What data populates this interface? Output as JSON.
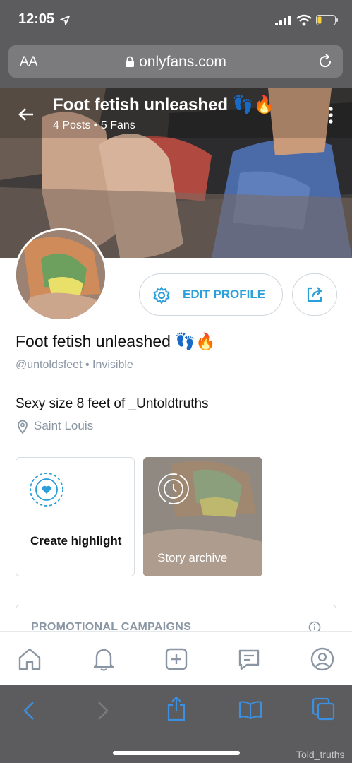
{
  "status_bar": {
    "time": "12:05"
  },
  "url_bar": {
    "aa_label": "AA",
    "domain": "onlyfans.com"
  },
  "cover": {
    "title": "Foot fetish unleashed 👣🔥",
    "stats": "4 Posts  •  5 Fans"
  },
  "profile": {
    "edit_label": "EDIT PROFILE",
    "name": "Foot fetish unleashed 👣🔥",
    "handle": "@untoldsfeet  •  Invisible",
    "bio": "Sexy size 8 feet of _Untoldtruths",
    "location": "Saint Louis"
  },
  "highlights": {
    "create_label": "Create highlight",
    "archive_label": "Story archive"
  },
  "promo": {
    "label": "PROMOTIONAL CAMPAIGNS"
  },
  "watermark": "Told_truths",
  "colors": {
    "accent": "#2b9fd9",
    "safari_tint": "#3d8fe0"
  },
  "icons": [
    "location-arrow-icon",
    "signal-icon",
    "wifi-icon",
    "battery-icon",
    "lock-icon",
    "reload-icon",
    "back-arrow-icon",
    "more-vertical-icon",
    "gear-icon",
    "share-icon",
    "map-pin-icon",
    "heart-dashed-circle-icon",
    "clock-icon",
    "info-icon",
    "home-icon",
    "bell-icon",
    "plus-square-icon",
    "message-icon",
    "profile-icon",
    "chevron-left-icon",
    "chevron-right-icon",
    "share-sheet-icon",
    "book-icon",
    "tabs-icon"
  ]
}
